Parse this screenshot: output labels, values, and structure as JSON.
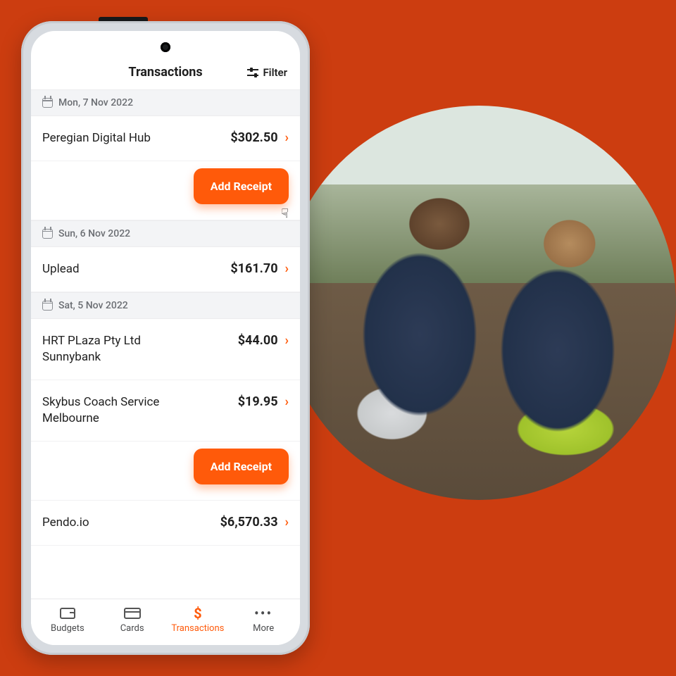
{
  "header": {
    "title": "Transactions",
    "filter_label": "Filter"
  },
  "add_receipt_label": "Add Receipt",
  "groups": [
    {
      "date": "Mon, 7 Nov 2022",
      "items": [
        {
          "name": "Peregian Digital Hub",
          "amount": "$302.50",
          "show_receipt_btn": true,
          "cursor": true
        }
      ]
    },
    {
      "date": "Sun, 6 Nov 2022",
      "items": [
        {
          "name": "Uplead",
          "amount": "$161.70"
        }
      ]
    },
    {
      "date": "Sat, 5 Nov 2022",
      "items": [
        {
          "name": "HRT PLaza Pty Ltd Sunnybank",
          "amount": "$44.00"
        },
        {
          "name": "Skybus Coach Service Melbourne",
          "amount": "$19.95",
          "show_receipt_btn": true
        },
        {
          "name": "Pendo.io",
          "amount": "$6,570.33"
        }
      ]
    }
  ],
  "nav": {
    "budgets": "Budgets",
    "cards": "Cards",
    "transactions": "Transactions",
    "more": "More",
    "active": "transactions"
  },
  "colors": {
    "accent": "#ff5a0a",
    "background": "#cc3d10"
  }
}
